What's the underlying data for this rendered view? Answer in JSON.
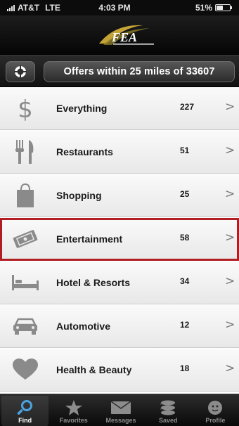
{
  "status_bar": {
    "carrier": "AT&T",
    "network": "LTE",
    "time": "4:03 PM",
    "battery": "51%",
    "battery_level": 0.51
  },
  "header": {
    "logo_text": "FEA"
  },
  "offers": {
    "summary": "Offers within 25 miles of 33607"
  },
  "categories": [
    {
      "label": "Everything",
      "count": "227",
      "icon": "dollar-icon"
    },
    {
      "label": "Restaurants",
      "count": "51",
      "icon": "fork-knife-icon"
    },
    {
      "label": "Shopping",
      "count": "25",
      "icon": "shopping-bag-icon"
    },
    {
      "label": "Entertainment",
      "count": "58",
      "icon": "ticket-icon",
      "selected": true
    },
    {
      "label": "Hotel & Resorts",
      "count": "34",
      "icon": "bed-icon"
    },
    {
      "label": "Automotive",
      "count": "12",
      "icon": "car-icon"
    },
    {
      "label": "Health & Beauty",
      "count": "18",
      "icon": "heart-icon"
    }
  ],
  "chevron": ">",
  "tabs": [
    {
      "label": "Find",
      "icon": "search-icon",
      "active": true
    },
    {
      "label": "Favorites",
      "icon": "star-icon"
    },
    {
      "label": "Messages",
      "icon": "envelope-icon"
    },
    {
      "label": "Saved",
      "icon": "coins-icon"
    },
    {
      "label": "Profile",
      "icon": "profile-icon"
    }
  ],
  "colors": {
    "highlight": "#b01e23",
    "active_tab_icon": "#4aa3e0",
    "icon_gray": "#8a8a8a"
  }
}
